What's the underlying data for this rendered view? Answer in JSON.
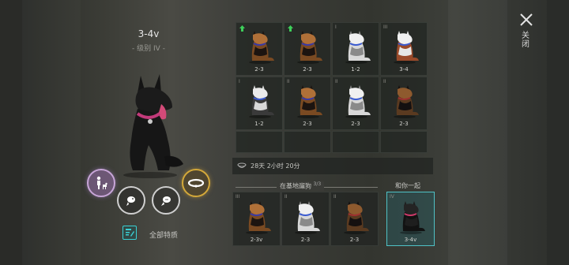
{
  "dog": {
    "name": "3-4v",
    "level": "- 级别 IV -"
  },
  "traits_label": "全部特质",
  "close_label": "关闭",
  "timer_text": "28天 2小时 20分",
  "kennel": {
    "title": "在基地遛狗",
    "count": "3/3",
    "with_you_label": "和你一起"
  },
  "grid_cells": [
    {
      "tier": "",
      "age": "2-3",
      "upgrade": true,
      "coat": "shepherd"
    },
    {
      "tier": "",
      "age": "2-3",
      "upgrade": true,
      "coat": "shepherd"
    },
    {
      "tier": "I",
      "age": "1-2",
      "upgrade": false,
      "coat": "husky-white"
    },
    {
      "tier": "III",
      "age": "3-4",
      "upgrade": false,
      "coat": "husky-red"
    },
    {
      "tier": "I",
      "age": "1-2",
      "upgrade": false,
      "coat": "husky-grey"
    },
    {
      "tier": "II",
      "age": "2-3",
      "upgrade": false,
      "coat": "shepherd"
    },
    {
      "tier": "II",
      "age": "2-3",
      "upgrade": false,
      "coat": "husky-white"
    },
    {
      "tier": "II",
      "age": "2-3",
      "upgrade": false,
      "coat": "shepherd-dark"
    }
  ],
  "kennel_cells": [
    {
      "tier": "III",
      "age": "2-3v",
      "coat": "shepherd"
    },
    {
      "tier": "II",
      "age": "2-3",
      "coat": "husky-white"
    },
    {
      "tier": "II",
      "age": "2-3",
      "coat": "shepherd-dark"
    }
  ],
  "companion_cell": {
    "tier": "IV",
    "age": "3-4v",
    "coat": "black"
  },
  "colors": {
    "accent_cyan": "#4fc2c6",
    "upgrade_green": "#3ecf5a",
    "gold": "#d4a93a",
    "purple": "#c8a6d8"
  },
  "action_icons": [
    "owner-with-dog-icon",
    "feed-icon",
    "treat-icon",
    "collar-icon"
  ]
}
